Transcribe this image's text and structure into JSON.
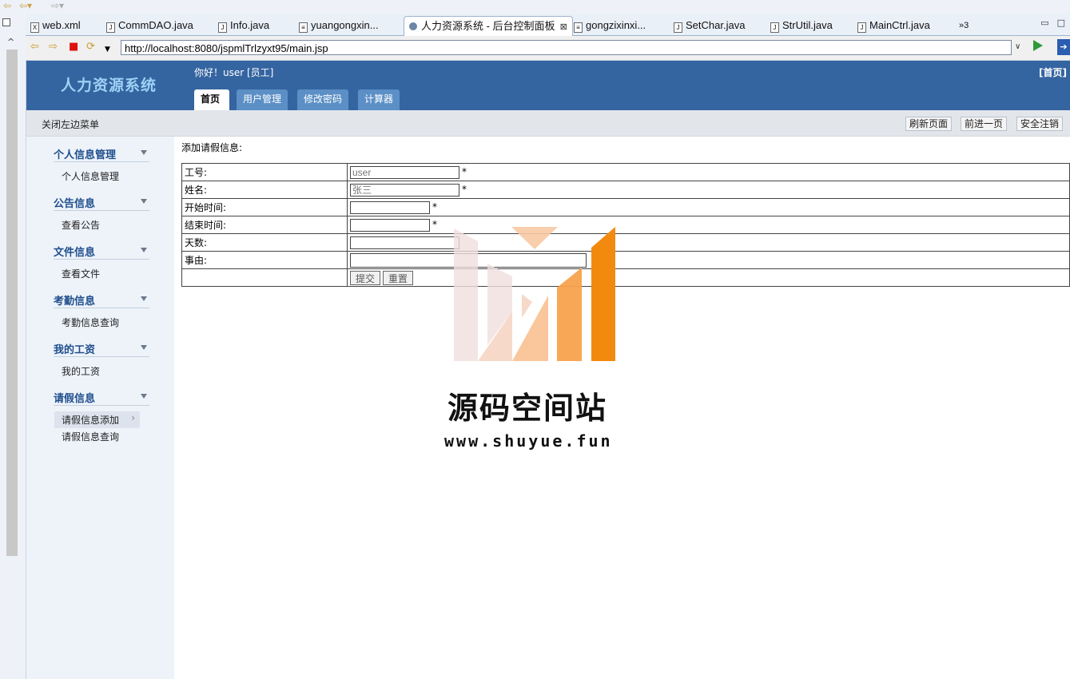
{
  "ide": {
    "tabs": [
      {
        "label": "web.xml",
        "type": "xml"
      },
      {
        "label": "CommDAO.java",
        "type": "java"
      },
      {
        "label": "Info.java",
        "type": "java"
      },
      {
        "label": "yuangongxin...",
        "type": "file"
      },
      {
        "label": "人力资源系统 - 后台控制面板",
        "type": "browser",
        "active": true
      },
      {
        "label": "gongzixinxi...",
        "type": "file"
      },
      {
        "label": "SetChar.java",
        "type": "java"
      },
      {
        "label": "StrUtil.java",
        "type": "java"
      },
      {
        "label": "MainCtrl.java",
        "type": "java"
      }
    ],
    "overflow_label": "»3",
    "url": "http://localhost:8080/jspmlTrlzyxt95/main.jsp"
  },
  "header": {
    "title": "人力资源系统",
    "greeting": "你好！user [员工]",
    "home_link": "[首页]",
    "nav_tabs": [
      "首页",
      "用户管理",
      "修改密码",
      "计算器"
    ]
  },
  "subbar": {
    "close_menu": "关闭左边菜单",
    "buttons": [
      "刷新页面",
      "前进一页",
      "安全注销"
    ]
  },
  "sidebar": {
    "groups": [
      {
        "title": "个人信息管理",
        "items": [
          "个人信息管理"
        ]
      },
      {
        "title": "公告信息",
        "items": [
          "查看公告"
        ]
      },
      {
        "title": "文件信息",
        "items": [
          "查看文件"
        ]
      },
      {
        "title": "考勤信息",
        "items": [
          "考勤信息查询"
        ]
      },
      {
        "title": "我的工资",
        "items": [
          "我的工资"
        ]
      },
      {
        "title": "请假信息",
        "items": [
          "请假信息添加",
          "请假信息查询"
        ]
      }
    ],
    "active_item": "请假信息添加"
  },
  "form": {
    "title": "添加请假信息:",
    "rows": [
      {
        "label": "工号:",
        "value": "user",
        "required": true
      },
      {
        "label": "姓名:",
        "value": "张三",
        "required": true
      },
      {
        "label": "开始时间:",
        "value": "",
        "required": true
      },
      {
        "label": "结束时间:",
        "value": "",
        "required": true
      },
      {
        "label": "天数:",
        "value": "",
        "required": false
      },
      {
        "label": "事由:",
        "value": "",
        "required": false
      }
    ],
    "submit_label": "提交",
    "reset_label": "重置",
    "required_mark": "*"
  },
  "watermark": {
    "text": "源码空间站",
    "url": "www.shuyue.fun"
  },
  "colors": {
    "header_bg": "#3565a1",
    "title": "#9fd1f5",
    "sidebar_bg": "#eef3fa",
    "group_title": "#1e4e8c"
  }
}
